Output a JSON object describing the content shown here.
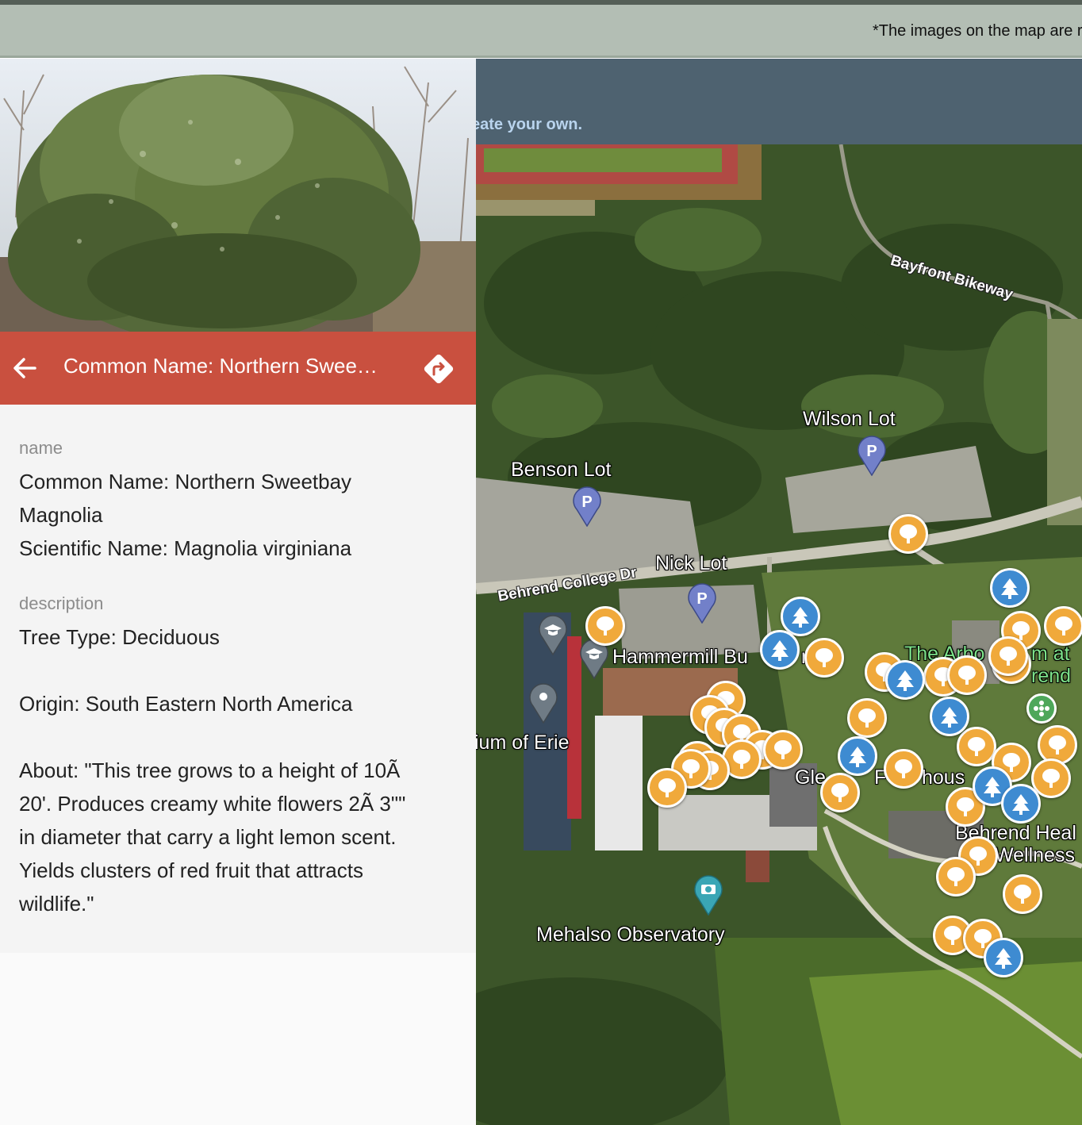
{
  "notice": {
    "text": "*The images on the map are r"
  },
  "map_header": {
    "text": "eate your own."
  },
  "panel": {
    "title": "Common Name: Northern Swee…",
    "fields": [
      {
        "label": "name",
        "value": "Common Name: Northern Sweetbay\nMagnolia\nScientific Name: Magnolia virginiana"
      },
      {
        "label": "description",
        "value": "Tree Type: Deciduous\n\nOrigin: South Eastern North America\n\nAbout: \"This tree grows to a height of 10Ã\n20'. Produces creamy white flowers 2Ã 3\"\"\nin diameter that carry a light lemon scent.\nYields clusters of red fruit that attracts\nwildlife.\""
      }
    ]
  },
  "map": {
    "labels": {
      "wilson_lot": "Wilson Lot",
      "benson_lot": "Benson Lot",
      "nick_lot": "Nick Lot",
      "hammermill": "Hammermill Bu",
      "hammermill_tail": "n",
      "museum": "ium of Erie",
      "glenhill_a": "Gle",
      "glenhill_b": "F",
      "glenhill_c": "hous",
      "arboretum_1a": "The Arbo",
      "arboretum_1b": "m at",
      "arboretum_2": "rend",
      "health_1": "Behrend Heal",
      "health_2": "Wellness",
      "observatory": "Mehalso Observatory",
      "behrend_college_dr": "Behrend College Dr",
      "bayfront_bikeway": "Bayfront Bikeway"
    }
  },
  "colors": {
    "accent": "#c9503f",
    "tree_marker": "#f0a93b",
    "conifer_marker": "#3e8bd1",
    "parking_marker": "#7280c9"
  }
}
